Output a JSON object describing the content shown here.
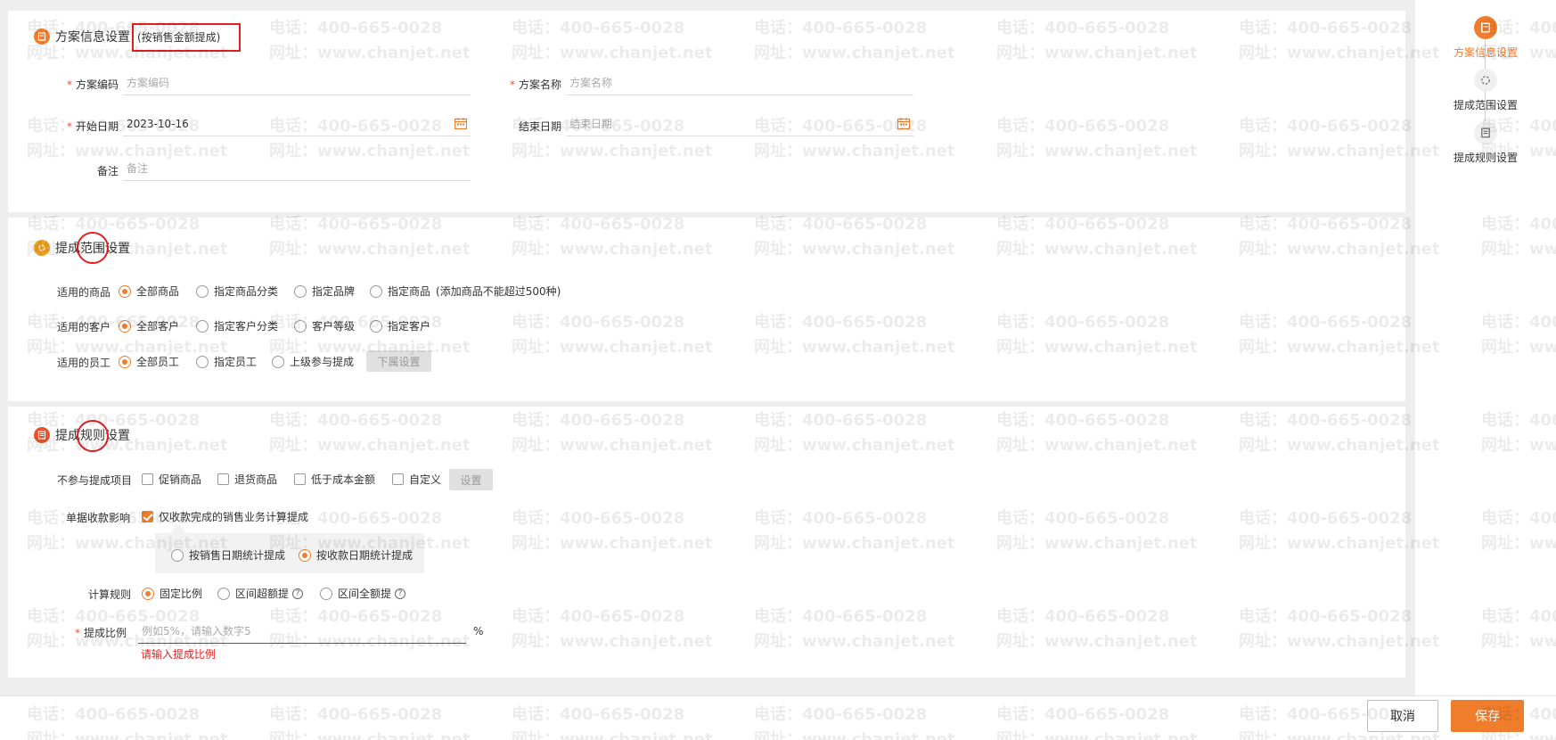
{
  "section_info": {
    "title": "方案信息设置",
    "subtitle": "(按销售金额提成)",
    "fields": {
      "code_label": "方案编码",
      "code_placeholder": "方案编码",
      "name_label": "方案名称",
      "name_placeholder": "方案名称",
      "start_label": "开始日期",
      "start_value": "2023-10-16",
      "end_label": "结束日期",
      "end_placeholder": "结束日期",
      "remark_label": "备注",
      "remark_placeholder": "备注"
    },
    "required_mark": "*"
  },
  "section_scope": {
    "title": "提成范围设置",
    "goods_label": "适用的商品",
    "goods_options": [
      "全部商品",
      "指定商品分类",
      "指定品牌",
      "指定商品"
    ],
    "goods_note": "(添加商品不能超过500种)",
    "customer_label": "适用的客户",
    "customer_options": [
      "全部客户",
      "指定客户分类",
      "客户等级",
      "指定客户"
    ],
    "staff_label": "适用的员工",
    "staff_options": [
      "全部员工",
      "指定员工",
      "上级参与提成"
    ],
    "subordinate_button": "下属设置"
  },
  "section_rules": {
    "title": "提成规则设置",
    "exclude_label": "不参与提成项目",
    "exclude_options": [
      "促销商品",
      "退货商品",
      "低于成本金额",
      "自定义"
    ],
    "exclude_button": "设置",
    "receipt_label": "单据收款影响",
    "receipt_check": "仅收款完成的销售业务计算提成",
    "receipt_sub_options": [
      "按销售日期统计提成",
      "按收款日期统计提成"
    ],
    "calc_label": "计算规则",
    "calc_options": [
      "固定比例",
      "区间超额提",
      "区间全额提"
    ],
    "help_glyph": "?",
    "ratio_label": "提成比例",
    "ratio_placeholder": "例如5%，请输入数字5",
    "ratio_unit": "%",
    "ratio_error": "请输入提成比例"
  },
  "sidebar": {
    "steps": [
      "方案信息设置",
      "提成范围设置",
      "提成规则设置"
    ]
  },
  "footer": {
    "cancel": "取消",
    "save": "保存"
  },
  "watermark": {
    "phone": "电话：400-665-0028",
    "site": "网址：www.chanjet.net"
  },
  "colors": {
    "accent": "#f07d2c",
    "error": "#e02020",
    "scope_icon": "#f0a020",
    "rules_icon": "#e8532b"
  }
}
